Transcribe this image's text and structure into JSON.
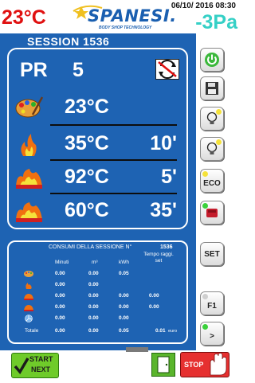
{
  "header": {
    "temperature_out": "23°C",
    "logo_text": "SPANESI.",
    "logo_sub": "BODY SHOP TECHNOLOGY",
    "datetime": "06/10/ 2016  08:30",
    "pressure": "-3Pa"
  },
  "session": {
    "title": "SESSION  1536"
  },
  "panel": {
    "pr_label": "PR",
    "pr_value": "5",
    "rows": [
      {
        "icon": "paint-palette-icon",
        "value": "23°C",
        "time": ""
      },
      {
        "icon": "flame-icon",
        "value": "35°C",
        "time": "10'"
      },
      {
        "icon": "heater-flame-icon",
        "value": "92°C",
        "time": "5'"
      },
      {
        "icon": "heater-flame-icon",
        "value": "60°C",
        "time": "35'"
      }
    ]
  },
  "consumption": {
    "title": "CONSUMI DELLA SESSIONE N°",
    "number": "1536",
    "headers": {
      "minuti": "Minuti",
      "m3": "m³",
      "kwh": "kWh",
      "tempo": "Tempo raggi. set"
    },
    "rows": [
      {
        "minuti": "0.00",
        "m3": "0.00",
        "kwh": "0.05",
        "tempo": ""
      },
      {
        "minuti": "0.00",
        "m3": "0.00",
        "kwh": "",
        "tempo": ""
      },
      {
        "minuti": "0.00",
        "m3": "0.00",
        "kwh": "0.00",
        "tempo": "0.00"
      },
      {
        "minuti": "0.00",
        "m3": "0.00",
        "kwh": "0.00",
        "tempo": "0.00"
      },
      {
        "minuti": "0.00",
        "m3": "0.00",
        "kwh": "0.00",
        "tempo": ""
      }
    ],
    "total": {
      "label": "Totale",
      "minuti": "0.00",
      "m3": "0.00",
      "kwh": "0.05",
      "tempo": "0.01",
      "currency": "euro"
    }
  },
  "buttons": {
    "eco": "ECO",
    "set": "SET",
    "f1": "F1",
    "next": ">",
    "start_l1": "START",
    "start_l2": "NEXT",
    "stop": "STOP"
  },
  "colors": {
    "main_bg": "#1e63b3",
    "temp_red": "#e01010",
    "pressure_cyan": "#35d0c6",
    "start_green": "#6fcb2a",
    "stop_red": "#e63030",
    "led_yellow": "#f5e23a",
    "led_green": "#3bd13b"
  }
}
